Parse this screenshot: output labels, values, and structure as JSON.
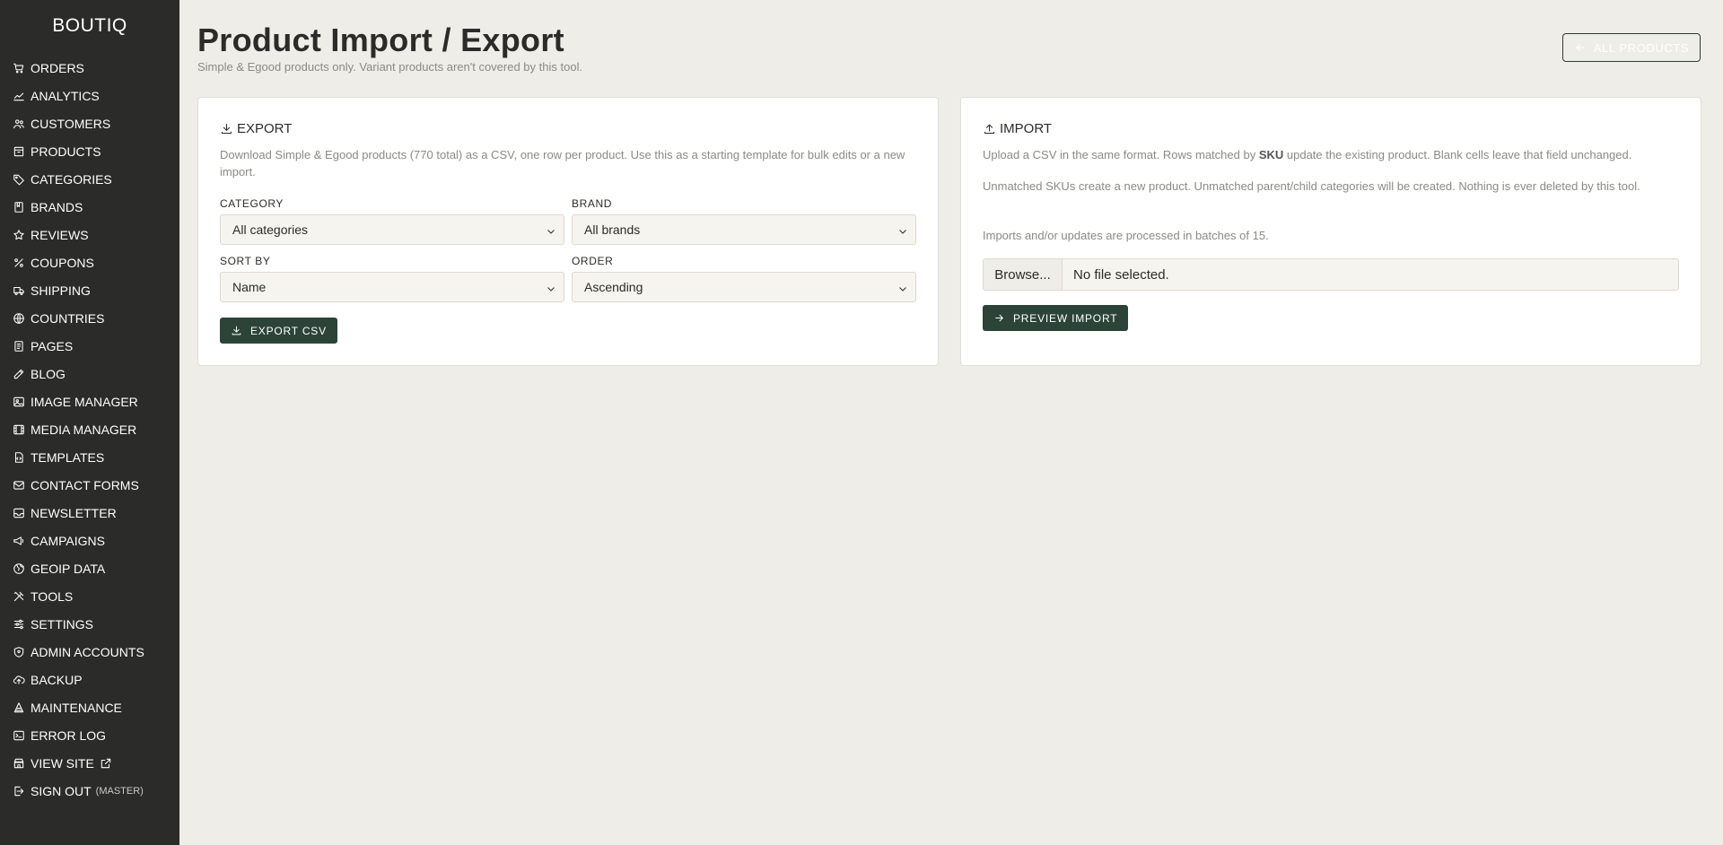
{
  "sidebar": {
    "brand": "BOUTIQ",
    "items": [
      {
        "label": "ORDERS",
        "icon": "cart-icon"
      },
      {
        "label": "ANALYTICS",
        "icon": "chart-line-icon"
      },
      {
        "label": "CUSTOMERS",
        "icon": "users-icon"
      },
      {
        "label": "PRODUCTS",
        "icon": "box-icon"
      },
      {
        "label": "CATEGORIES",
        "icon": "tag-icon"
      },
      {
        "label": "BRANDS",
        "icon": "bookmark-icon"
      },
      {
        "label": "REVIEWS",
        "icon": "star-icon"
      },
      {
        "label": "COUPONS",
        "icon": "percent-icon"
      },
      {
        "label": "SHIPPING",
        "icon": "truck-icon"
      },
      {
        "label": "COUNTRIES",
        "icon": "globe-icon"
      },
      {
        "label": "PAGES",
        "icon": "page-icon"
      },
      {
        "label": "BLOG",
        "icon": "edit-icon"
      },
      {
        "label": "IMAGE MANAGER",
        "icon": "image-icon"
      },
      {
        "label": "MEDIA MANAGER",
        "icon": "film-icon"
      },
      {
        "label": "TEMPLATES",
        "icon": "file-code-icon"
      },
      {
        "label": "CONTACT FORMS",
        "icon": "mail-icon"
      },
      {
        "label": "NEWSLETTER",
        "icon": "inbox-icon"
      },
      {
        "label": "CAMPAIGNS",
        "icon": "megaphone-icon"
      },
      {
        "label": "GEOIP DATA",
        "icon": "globe-pin-icon"
      },
      {
        "label": "TOOLS",
        "icon": "tools-icon"
      },
      {
        "label": "SETTINGS",
        "icon": "sliders-icon"
      },
      {
        "label": "ADMIN ACCOUNTS",
        "icon": "shield-icon"
      },
      {
        "label": "BACKUP",
        "icon": "cloud-upload-icon"
      },
      {
        "label": "MAINTENANCE",
        "icon": "cone-icon"
      },
      {
        "label": "ERROR LOG",
        "icon": "terminal-icon"
      },
      {
        "label": "VIEW SITE",
        "icon": "store-icon"
      },
      {
        "label": "SIGN OUT",
        "suffix": "(MASTER)",
        "icon": "sign-out-icon"
      }
    ]
  },
  "header": {
    "title": "Product Import / Export",
    "subtitle": "Simple & Egood products only. Variant products aren't covered by this tool.",
    "back_label": "ALL PRODUCTS"
  },
  "export": {
    "heading": "EXPORT",
    "description": "Download Simple & Egood products (770 total) as a CSV, one row per product. Use this as a starting template for bulk edits or a new import.",
    "category_label": "CATEGORY",
    "category_value": "All categories",
    "brand_label": "BRAND",
    "brand_value": "All brands",
    "sort_label": "SORT BY",
    "sort_value": "Name",
    "order_label": "ORDER",
    "order_value": "Ascending",
    "button_label": "EXPORT CSV"
  },
  "import": {
    "heading": "IMPORT",
    "desc1_pre": "Upload a CSV in the same format. Rows matched by ",
    "desc1_bold": "SKU",
    "desc1_post": " update the existing product. Blank cells leave that field unchanged.",
    "desc2": "Unmatched SKUs create a new product. Unmatched parent/child categories will be created. Nothing is ever deleted by this tool.",
    "desc3": "Imports and/or updates are processed in batches of 15.",
    "browse_label": "Browse...",
    "file_status": "No file selected.",
    "button_label": "PREVIEW IMPORT"
  }
}
